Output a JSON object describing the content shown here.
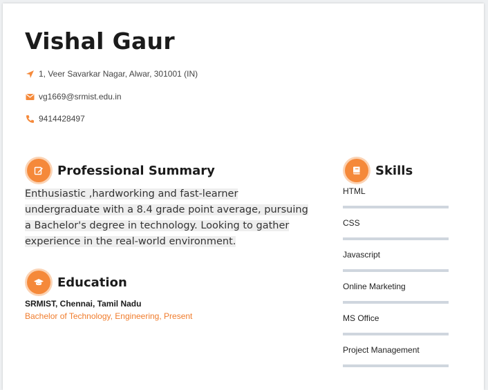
{
  "header": {
    "name": "Vishal Gaur",
    "address": "1, Veer Savarkar Nagar, Alwar, 301001 (IN)",
    "email": "vg1669@srmist.edu.in",
    "phone": "9414428497"
  },
  "summary": {
    "title": "Professional Summary",
    "text": "Enthusiastic ,hardworking and fast-learner undergraduate with a 8.4 grade point average, pursuing a Bachelor's degree in technology. Looking to gather experience in the real-world environment."
  },
  "education": {
    "title": "Education",
    "school": "SRMIST, Chennai, Tamil Nadu",
    "degree": "Bachelor of Technology, Engineering, Present"
  },
  "skills": {
    "title": "Skills",
    "items": [
      "HTML",
      "CSS",
      "Javascript",
      "Online Marketing",
      "MS Office",
      "Project Management"
    ]
  },
  "colors": {
    "accent": "#f5893a",
    "accent_ring": "#fbd3b4",
    "skill_bar": "#cfd6de"
  }
}
